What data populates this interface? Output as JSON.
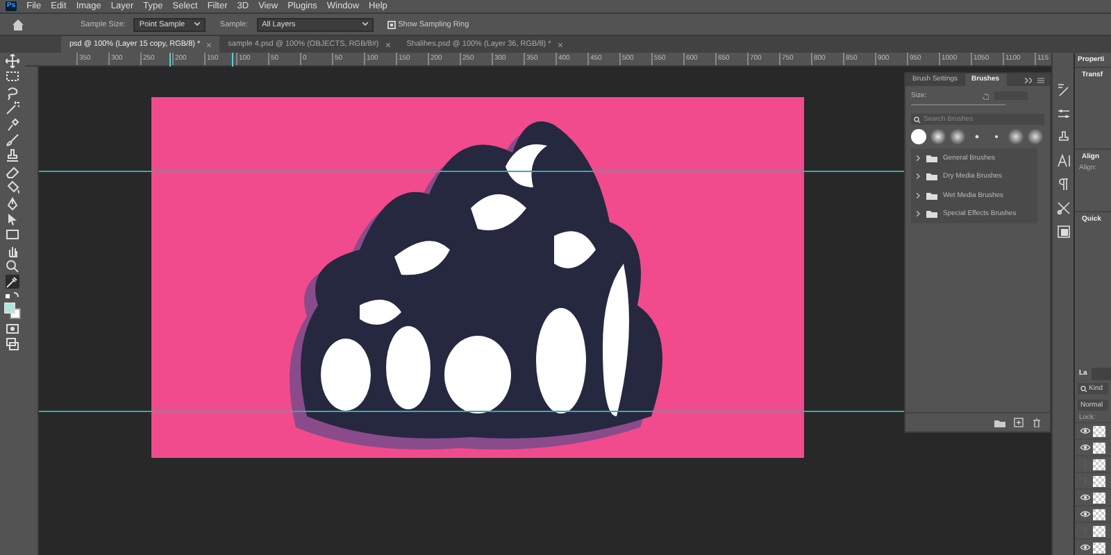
{
  "menu": {
    "app_badge": "Ps",
    "items": [
      "File",
      "Edit",
      "Image",
      "Layer",
      "Type",
      "Select",
      "Filter",
      "3D",
      "View",
      "Plugins",
      "Window",
      "Help"
    ]
  },
  "options": {
    "sample_size_label": "Sample Size:",
    "sample_size": "Point Sample",
    "sample_label": "Sample:",
    "sample": "All Layers",
    "show_sampling_ring": {
      "label": "Show Sampling Ring",
      "checked": true
    }
  },
  "tabs": [
    {
      "label": "psd @ 100% (Layer 15 copy, RGB/8) *",
      "selected": true
    },
    {
      "label": "sample 4.psd @ 100% (OBJECTS, RGB/8#)",
      "selected": false
    },
    {
      "label": "Shalihes.psd @ 100% (Layer 36, RGB/8) *",
      "selected": false
    }
  ],
  "ruler": {
    "labels": [
      "350",
      "300",
      "250",
      "200",
      "150",
      "100",
      "50",
      "0",
      "50",
      "100",
      "150",
      "200",
      "250",
      "300",
      "350",
      "400",
      "450",
      "500",
      "550",
      "600",
      "650",
      "700",
      "750",
      "800",
      "850",
      "900",
      "950",
      "1000",
      "1050",
      "1100",
      "115"
    ]
  },
  "brushes_panel": {
    "tabs": [
      {
        "label": "Brush Settings",
        "selected": false
      },
      {
        "label": "Brushes",
        "selected": true
      }
    ],
    "size_label": "Size:",
    "search": {
      "placeholder": "Search Brushes"
    },
    "folders": [
      "General Brushes",
      "Dry Media Brushes",
      "Wet Media Brushes",
      "Special Effects Brushes"
    ]
  },
  "properties_panel": {
    "title": "Properti",
    "sections": [
      "Transf",
      "Align",
      "Quick"
    ],
    "align_label": "Align:"
  },
  "layers_panel": {
    "tab": "La",
    "filter": "Kind",
    "blend_mode": "Normal",
    "lock_label": "Lock:",
    "layers": [
      {
        "visible": true
      },
      {
        "visible": true
      },
      {
        "visible": false
      },
      {
        "visible": false
      },
      {
        "visible": true
      },
      {
        "visible": true
      },
      {
        "visible": false
      },
      {
        "visible": true
      }
    ]
  }
}
